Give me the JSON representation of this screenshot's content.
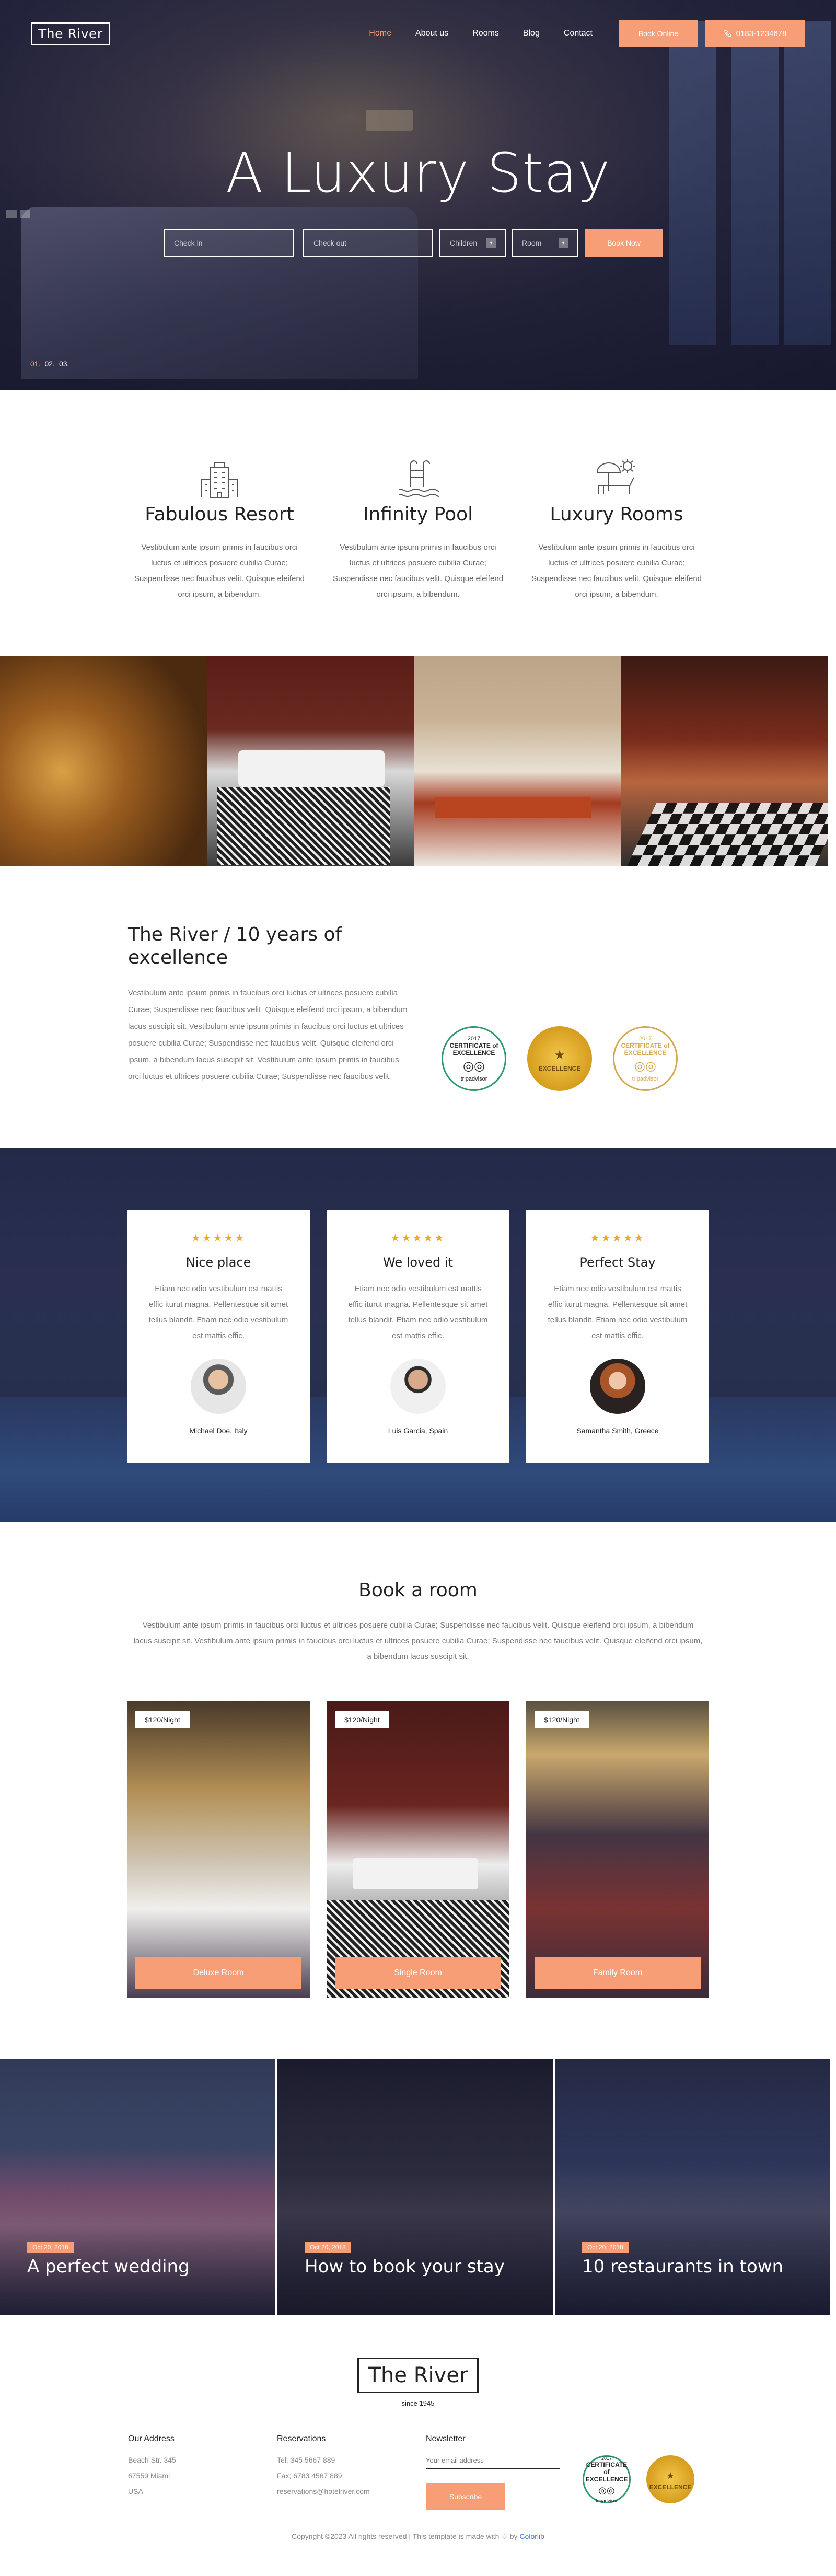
{
  "header": {
    "logo": "The River",
    "nav": [
      "Home",
      "About us",
      "Rooms",
      "Blog",
      "Contact"
    ],
    "active_nav": "Home",
    "book_online": "Book Online",
    "phone": "0183-1234678"
  },
  "hero": {
    "title": "A Luxury Stay",
    "check_in_placeholder": "Check in",
    "check_out_placeholder": "Check out",
    "children_label": "Children",
    "room_label": "Room",
    "book_now": "Book Now",
    "slides": [
      "01.",
      "02.",
      "03."
    ]
  },
  "features": [
    {
      "icon": "building-icon",
      "title": "Fabulous Resort",
      "text": "Vestibulum ante ipsum primis in faucibus orci luctus et ultrices posuere cubilia Curae; Suspendisse nec faucibus velit. Quisque eleifend orci ipsum, a bibendum."
    },
    {
      "icon": "pool-icon",
      "title": "Infinity Pool",
      "text": "Vestibulum ante ipsum primis in faucibus orci luctus et ultrices posuere cubilia Curae; Suspendisse nec faucibus velit. Quisque eleifend orci ipsum, a bibendum."
    },
    {
      "icon": "sunbed-icon",
      "title": "Luxury Rooms",
      "text": "Vestibulum ante ipsum primis in faucibus orci luctus et ultrices posuere cubilia Curae; Suspendisse nec faucibus velit. Quisque eleifend orci ipsum, a bibendum."
    }
  ],
  "about": {
    "title": "The River / 10 years of excellence",
    "text": "Vestibulum ante ipsum primis in faucibus orci luctus et ultrices posuere cubilia Curae; Suspendisse nec faucibus velit. Quisque eleifend orci ipsum, a bibendum lacus suscipit sit. Vestibulum ante ipsum primis in faucibus orci luctus et ultrices posuere cubilia Curae; Suspendisse nec faucibus velit. Quisque eleifend orci ipsum, a bibendum lacus suscipit sit. Vestibulum ante ipsum primis in faucibus orci luctus et ultrices posuere cubilia Curae; Suspendisse nec faucibus velit.",
    "awards": [
      {
        "year": "2017",
        "label": "CERTIFICATE of EXCELLENCE",
        "brand": "tripadvisor"
      },
      {
        "year": "",
        "label": "EXCELLENCE",
        "brand": ""
      },
      {
        "year": "2017",
        "label": "CERTIFICATE of EXCELLENCE",
        "brand": "tripadvisor"
      }
    ]
  },
  "testimonials": [
    {
      "stars": "★★★★★",
      "title": "Nice place",
      "text": "Etiam nec odio vestibulum est mattis effic iturut magna. Pellentesque sit amet tellus blandit. Etiam nec odio vestibulum est mattis effic.",
      "name": "Michael Doe, Italy"
    },
    {
      "stars": "★★★★★",
      "title": "We loved it",
      "text": "Etiam nec odio vestibulum est mattis effic iturut magna. Pellentesque sit amet tellus blandit. Etiam nec odio vestibulum est mattis effic.",
      "name": "Luis Garcia, Spain"
    },
    {
      "stars": "★★★★★",
      "title": "Perfect Stay",
      "text": "Etiam nec odio vestibulum est mattis effic iturut magna. Pellentesque sit amet tellus blandit. Etiam nec odio vestibulum est mattis effic.",
      "name": "Samantha Smith, Greece"
    }
  ],
  "book_room": {
    "title": "Book a room",
    "text": "Vestibulum ante ipsum primis in faucibus orci luctus et ultrices posuere cubilia Curae; Suspendisse nec faucibus velit. Quisque eleifend orci ipsum, a bibendum lacus suscipit sit. Vestibulum ante ipsum primis in faucibus orci luctus et ultrices posuere cubilia Curae; Suspendisse nec faucibus velit. Quisque eleifend orci ipsum, a bibendum lacus suscipit sit.",
    "rooms": [
      {
        "price": "$120/Night",
        "name": "Deluxe Room"
      },
      {
        "price": "$120/Night",
        "name": "Single Room"
      },
      {
        "price": "$120/Night",
        "name": "Family Room"
      }
    ]
  },
  "blog": [
    {
      "date": "Oct 20, 2018",
      "title": "A perfect wedding"
    },
    {
      "date": "Oct 20, 2018",
      "title": "How to book your stay"
    },
    {
      "date": "Oct 20, 2018",
      "title": "10 restaurants in town"
    }
  ],
  "footer": {
    "logo": "The River",
    "since": "since 1945",
    "address_title": "Our Address",
    "address": [
      "Beach Str. 345",
      "67559 Miami",
      "USA"
    ],
    "reservations_title": "Reservations",
    "reservations": [
      "Tel: 345 5667 889",
      "Fax; 6783 4567 889",
      "reservations@hotelriver.com"
    ],
    "newsletter_title": "Newsletter",
    "email_placeholder": "Your email address",
    "subscribe": "Subscribe",
    "copyright": "Copyright ©2023 All rights reserved | This template is made with",
    "heart": "♡",
    "by": "by",
    "credit": "Colorlib"
  },
  "colors": {
    "accent": "#f89e76",
    "star": "#f5a623"
  }
}
